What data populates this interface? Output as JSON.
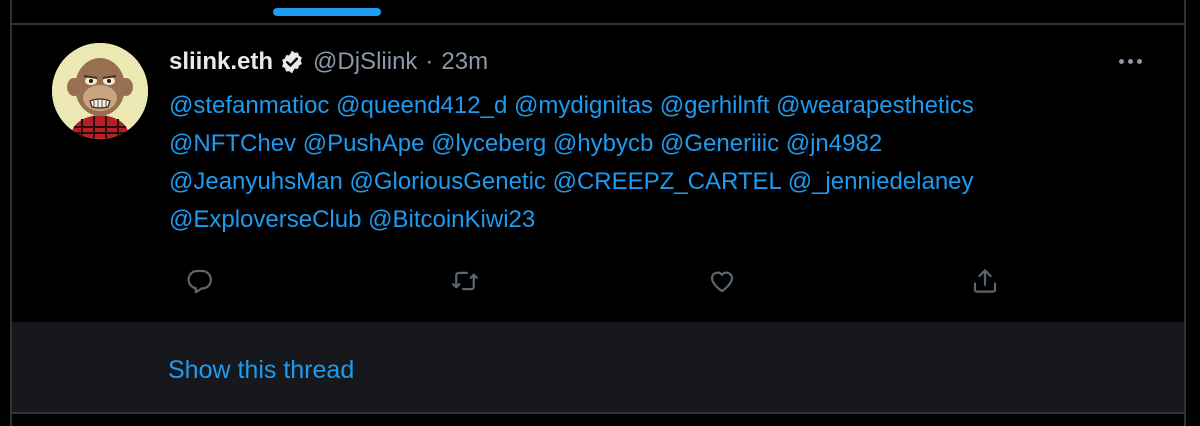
{
  "tweet": {
    "display_name": "sliink.eth",
    "handle": "@DjSliink",
    "separator": "·",
    "time": "23m",
    "mentions": [
      "@stefanmatioc",
      "@queend412_d",
      "@mydignitas",
      "@gerhilnft",
      "@wearapesthetics",
      "@NFTChev",
      "@PushApe",
      "@lyceberg",
      "@hybycb",
      "@Generiiic",
      "@jn4982",
      "@JeanyuhsMan",
      "@GloriousGenetic",
      "@CREEPZ_CARTEL",
      "@_jenniedelaney",
      "@ExploverseClub",
      "@BitcoinKiwi23"
    ],
    "show_thread_label": "Show this thread"
  },
  "icons": {
    "verified": "verified-badge-icon",
    "more": "more-icon",
    "reply": "reply-icon",
    "retweet": "retweet-icon",
    "like": "heart-icon",
    "share": "share-icon"
  },
  "colors": {
    "background": "#000000",
    "accent": "#1d9bf0",
    "secondary_text": "#8b98a5",
    "action_icon": "#5b6670",
    "thread_panel": "#16181c",
    "border": "#2f3336"
  }
}
